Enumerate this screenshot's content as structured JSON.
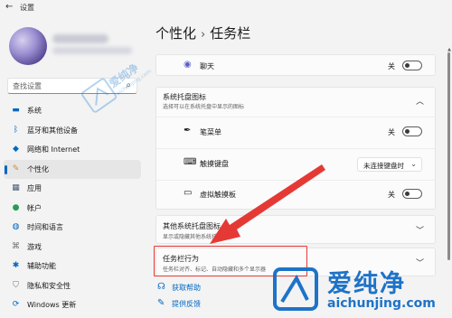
{
  "window": {
    "title": "设置",
    "back_glyph": "←"
  },
  "account": {
    "avatar": "avatar-image"
  },
  "search": {
    "placeholder": "查找设置",
    "icon": "search-icon"
  },
  "nav": [
    {
      "label": "系统",
      "icon": "monitor-icon",
      "color": "#0067c0",
      "glyph": "▬"
    },
    {
      "label": "蓝牙和其他设备",
      "icon": "bluetooth-icon",
      "color": "#0067c0",
      "glyph": "ᛒ"
    },
    {
      "label": "网络和 Internet",
      "icon": "wifi-icon",
      "color": "#0067c0",
      "glyph": "◆"
    },
    {
      "label": "个性化",
      "icon": "pen-icon",
      "color": "#d08a2b",
      "glyph": "✎",
      "selected": true
    },
    {
      "label": "应用",
      "icon": "apps-icon",
      "color": "#4a5a78",
      "glyph": "▦"
    },
    {
      "label": "帐户",
      "icon": "person-icon",
      "color": "#2b9a55",
      "glyph": "●"
    },
    {
      "label": "时间和语言",
      "icon": "globe-clock-icon",
      "color": "#0067c0",
      "glyph": "◍"
    },
    {
      "label": "游戏",
      "icon": "gamepad-icon",
      "color": "#6a6a6a",
      "glyph": "⌘"
    },
    {
      "label": "辅助功能",
      "icon": "accessibility-icon",
      "color": "#0067c0",
      "glyph": "✱"
    },
    {
      "label": "隐私和安全性",
      "icon": "shield-icon",
      "color": "#707070",
      "glyph": "⛉"
    },
    {
      "label": "Windows 更新",
      "icon": "update-icon",
      "color": "#0067c0",
      "glyph": "⟳"
    }
  ],
  "breadcrumb": {
    "parent": "个性化",
    "separator": "›",
    "current": "任务栏"
  },
  "chat_row": {
    "label": "聊天",
    "toggle_label": "关"
  },
  "tray_section": {
    "title": "系统托盘图标",
    "subtitle": "选择可以在系统托盘中显示的图标",
    "items": [
      {
        "label": "笔菜单",
        "icon": "pen-menu-icon",
        "glyph": "✒",
        "control": "toggle",
        "value": "关"
      },
      {
        "label": "触摸键盘",
        "icon": "keyboard-icon",
        "glyph": "⌨",
        "control": "select",
        "value": "未连接键盘时"
      },
      {
        "label": "虚拟触摸板",
        "icon": "touchpad-icon",
        "glyph": "▭",
        "control": "toggle",
        "value": "关"
      }
    ]
  },
  "other_tray": {
    "title": "其他系统托盘图标",
    "subtitle": "显示或隐藏其他系统托盘图标"
  },
  "taskbar_behavior": {
    "title": "任务栏行为",
    "subtitle": "任务栏对齐、标记、自动隐藏和多个显示器"
  },
  "links": [
    {
      "label": "获取帮助",
      "icon": "help-icon",
      "glyph": "☊"
    },
    {
      "label": "提供反馈",
      "icon": "feedback-icon",
      "glyph": "✎"
    }
  ],
  "watermark": {
    "brand": "爱纯净",
    "url": "aichunjing.com"
  },
  "colors": {
    "accent": "#0067c0",
    "highlight": "#e53935",
    "arrow": "#e53935"
  }
}
